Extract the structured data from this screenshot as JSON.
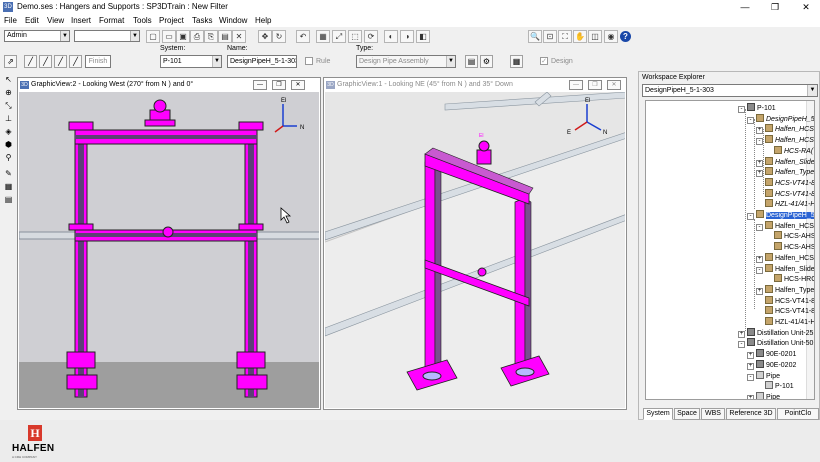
{
  "window": {
    "app_icon": "3D",
    "title": "Demo.ses : Hangers and Supports : SP3DTrain : New Filter",
    "minimize": "—",
    "restore": "❐",
    "close": "✕"
  },
  "menu": [
    "File",
    "Edit",
    "View",
    "Insert",
    "Format",
    "Tools",
    "Project",
    "Tasks",
    "Window",
    "Help"
  ],
  "toolbar": {
    "permission_group": "Admin",
    "filter_combo": "",
    "icons": [
      "new-icon",
      "open-icon",
      "save-icon",
      "print-icon",
      "copy-icon",
      "paste-icon",
      "delete-icon",
      "move-icon",
      "rotate-icon",
      "undo-icon",
      "properties-icon",
      "measure-icon",
      "select-icon",
      "refresh-icon",
      "hide-icon",
      "show-icon",
      "clip-icon",
      "zoom-icon",
      "zoom-area-icon",
      "fit-icon",
      "pan-icon",
      "view-icon",
      "render-icon",
      "layers-icon"
    ],
    "help": "?"
  },
  "ribbon": {
    "system_label": "System:",
    "system_value": "P-101",
    "name_label": "Name:",
    "name_value": "DesignPipeH_5-1-303",
    "rule_label": "Rule",
    "type_label": "Type:",
    "type_value": "Design Pipe Assembly",
    "design_label": "Design",
    "finish_label": "Finish"
  },
  "views": {
    "left": {
      "title": "GraphicView:2 - Looking West (270° from N ) and 0°",
      "compass_up": "El",
      "compass_right": "N"
    },
    "right": {
      "title": "GraphicView:1 - Looking NE (45° from N ) and 35° Down",
      "compass_up": "El",
      "compass_right": "N",
      "compass_left": "E"
    }
  },
  "explorer": {
    "title": "Workspace Explorer",
    "combo_value": "DesignPipeH_5-1-303",
    "tree": [
      {
        "label": "P-101",
        "level": 0,
        "icon": "sys",
        "expander": "-",
        "italic": false,
        "selected": false
      },
      {
        "label": "DesignPipeH_5-1-",
        "level": 1,
        "icon": "assembly",
        "expander": "-",
        "italic": true,
        "selected": false
      },
      {
        "label": "Halfen_HCS-",
        "level": 2,
        "icon": "part",
        "expander": "+",
        "italic": true,
        "selected": false
      },
      {
        "label": "Halfen_HCS-",
        "level": 2,
        "icon": "part",
        "expander": "-",
        "italic": true,
        "selected": false
      },
      {
        "label": "HCS-RA(",
        "level": 3,
        "icon": "part",
        "expander": "",
        "italic": true,
        "selected": false
      },
      {
        "label": "Halfen_SlideS",
        "level": 2,
        "icon": "part",
        "expander": "+",
        "italic": true,
        "selected": false
      },
      {
        "label": "Halfen_Type-",
        "level": 2,
        "icon": "part",
        "expander": "+",
        "italic": true,
        "selected": false
      },
      {
        "label": "HCS-VT41-84",
        "level": 2,
        "icon": "part",
        "expander": "",
        "italic": true,
        "selected": false
      },
      {
        "label": "HCS-VT41-84",
        "level": 2,
        "icon": "part",
        "expander": "",
        "italic": true,
        "selected": false
      },
      {
        "label": "HZL-41/41-H",
        "level": 2,
        "icon": "part",
        "expander": "",
        "italic": true,
        "selected": false
      },
      {
        "label": "DesignPipeH_5-1",
        "level": 1,
        "icon": "assembly",
        "expander": "-",
        "italic": false,
        "selected": true
      },
      {
        "label": "Halfen_HCS-",
        "level": 2,
        "icon": "part",
        "expander": "-",
        "italic": false,
        "selected": false
      },
      {
        "label": "HCS-AHS",
        "level": 3,
        "icon": "part",
        "expander": "",
        "italic": false,
        "selected": false
      },
      {
        "label": "HCS-AHS",
        "level": 3,
        "icon": "part",
        "expander": "",
        "italic": false,
        "selected": false
      },
      {
        "label": "Halfen_HCS-",
        "level": 2,
        "icon": "part",
        "expander": "+",
        "italic": false,
        "selected": false
      },
      {
        "label": "Halfen_SlideS",
        "level": 2,
        "icon": "part",
        "expander": "-",
        "italic": false,
        "selected": false
      },
      {
        "label": "HCS-HRG",
        "level": 3,
        "icon": "part",
        "expander": "",
        "italic": false,
        "selected": false
      },
      {
        "label": "Halfen_Type-",
        "level": 2,
        "icon": "part",
        "expander": "+",
        "italic": false,
        "selected": false
      },
      {
        "label": "HCS-VT41-84",
        "level": 2,
        "icon": "part",
        "expander": "",
        "italic": false,
        "selected": false
      },
      {
        "label": "HCS-VT41-84",
        "level": 2,
        "icon": "part",
        "expander": "",
        "italic": false,
        "selected": false
      },
      {
        "label": "HZL-41/41-H",
        "level": 2,
        "icon": "part",
        "expander": "",
        "italic": false,
        "selected": false
      },
      {
        "label": "Distillation Unit-25",
        "level": 0,
        "icon": "sys",
        "expander": "+",
        "italic": false,
        "selected": false
      },
      {
        "label": "Distillation Unit-50",
        "level": 0,
        "icon": "sys",
        "expander": "-",
        "italic": false,
        "selected": false
      },
      {
        "label": "90E-0201",
        "level": 1,
        "icon": "sys",
        "expander": "+",
        "italic": false,
        "selected": false
      },
      {
        "label": "90E-0202",
        "level": 1,
        "icon": "sys",
        "expander": "+",
        "italic": false,
        "selected": false
      },
      {
        "label": "Pipe",
        "level": 1,
        "icon": "pipe",
        "expander": "-",
        "italic": false,
        "selected": false
      },
      {
        "label": "P-101",
        "level": 2,
        "icon": "pipe",
        "expander": "",
        "italic": false,
        "selected": false
      },
      {
        "label": "Pipe",
        "level": 1,
        "icon": "pipe",
        "expander": "+",
        "italic": false,
        "selected": false
      }
    ],
    "tabs": [
      "System",
      "Space",
      "WBS",
      "Reference 3D",
      "PointClo"
    ]
  },
  "brand": {
    "logo_text": "HALFEN",
    "logo_sub": "A CRH COMPANY",
    "accent": "#ff00ff",
    "logo_red": "#d8392b"
  }
}
